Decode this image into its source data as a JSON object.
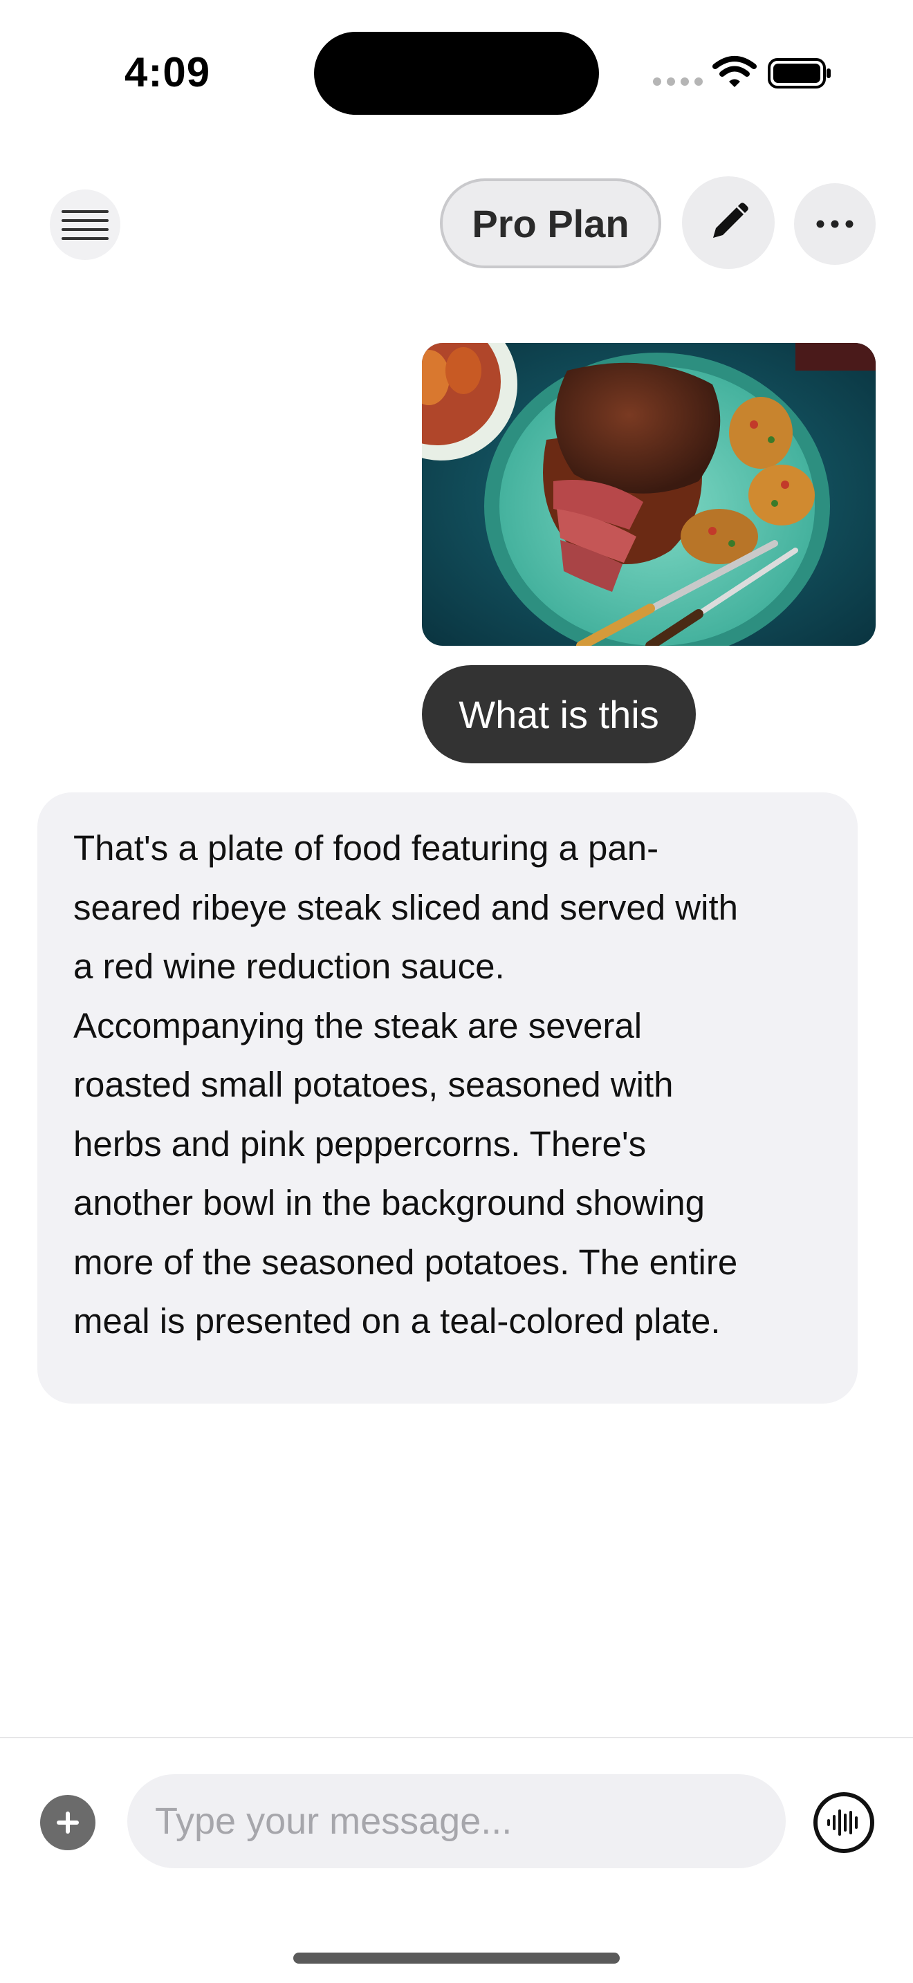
{
  "status_bar": {
    "time": "4:09",
    "icons": [
      "cellular-signal-icon",
      "wifi-icon",
      "battery-icon"
    ]
  },
  "header": {
    "menu_icon": "hamburger-menu-icon",
    "plan_label": "Pro Plan",
    "edit_icon": "pencil-icon",
    "more_icon": "ellipsis-icon"
  },
  "conversation": {
    "user_image": {
      "description_icon": "food-photo",
      "palette": {
        "background": "#0f4f5c",
        "plate": "#5fc9b4",
        "steak": "#5a2a1a",
        "potato": "#c8842e"
      }
    },
    "user_message": "What is this",
    "assistant_message": "That's a plate of food featuring a pan-\nseared ribeye steak sliced and served with\na red wine reduction sauce.\nAccompanying the steak are several\nroasted small potatoes, seasoned with\nherbs and pink peppercorns.  There's\nanother bowl in the background showing\nmore of the seasoned potatoes.  The entire\nmeal is presented on a teal-colored plate."
  },
  "composer": {
    "add_icon": "plus-icon",
    "placeholder": "Type your message...",
    "value": "",
    "voice_icon": "voice-waveform-icon"
  },
  "colors": {
    "user_bubble": "#333333",
    "assistant_bubble": "#f2f2f5",
    "input_background": "#f0f0f3",
    "button_background": "#ececee"
  }
}
